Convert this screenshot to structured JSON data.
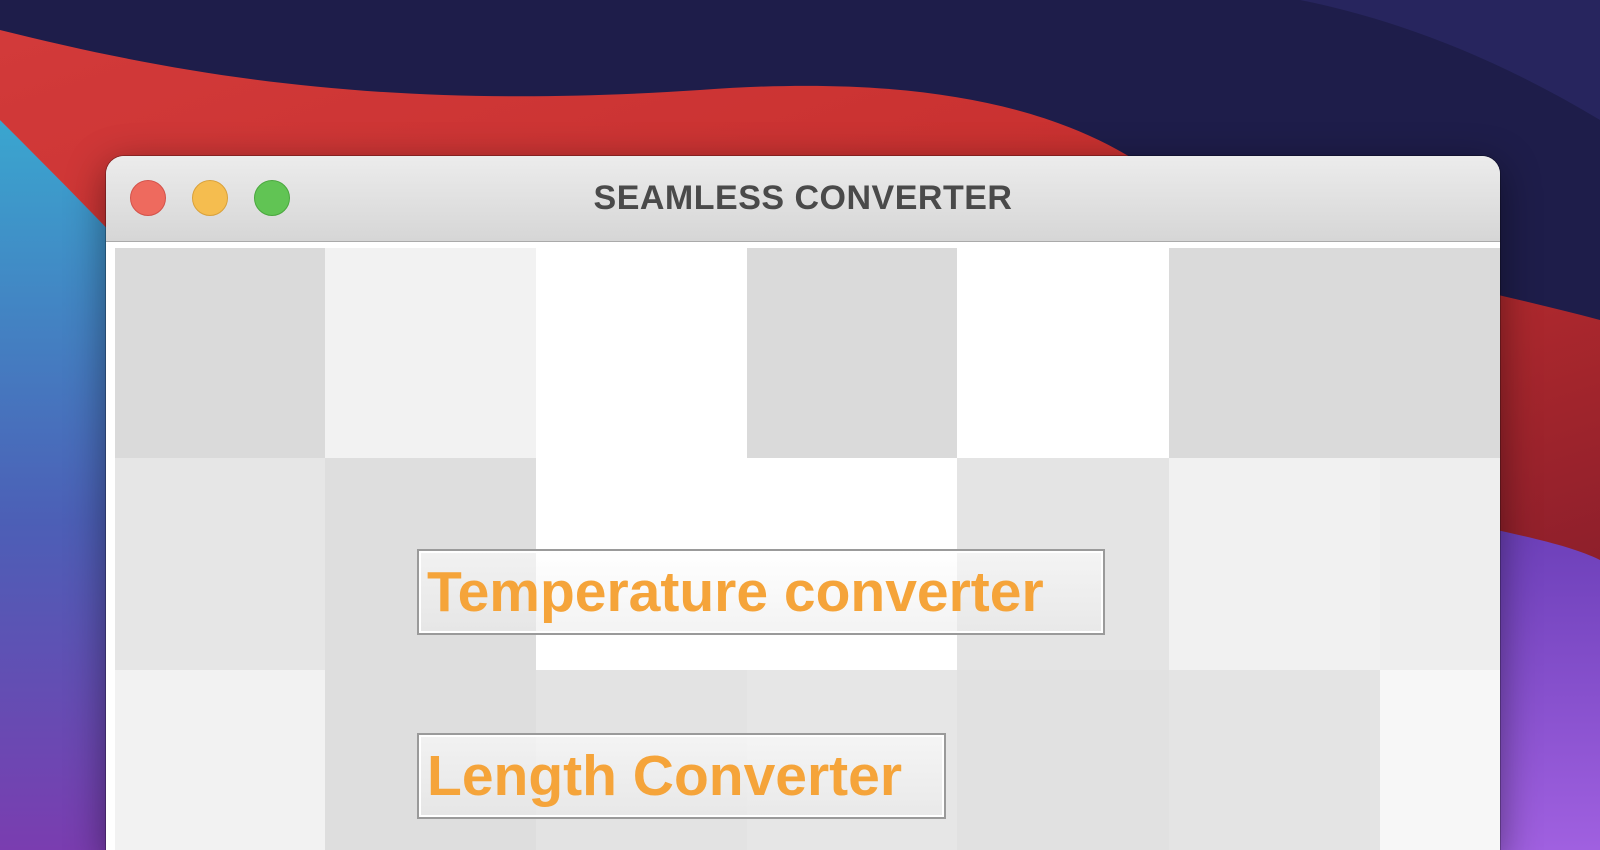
{
  "window": {
    "title": "SEAMLESS CONVERTER"
  },
  "colors": {
    "accent_text": "#f5a43a",
    "close_button": "#ee6a5e",
    "minimize_button": "#f5bd4f",
    "maximize_button": "#61c454"
  },
  "menu": {
    "temperature_label": "Temperature converter",
    "length_label": "Length Converter"
  }
}
